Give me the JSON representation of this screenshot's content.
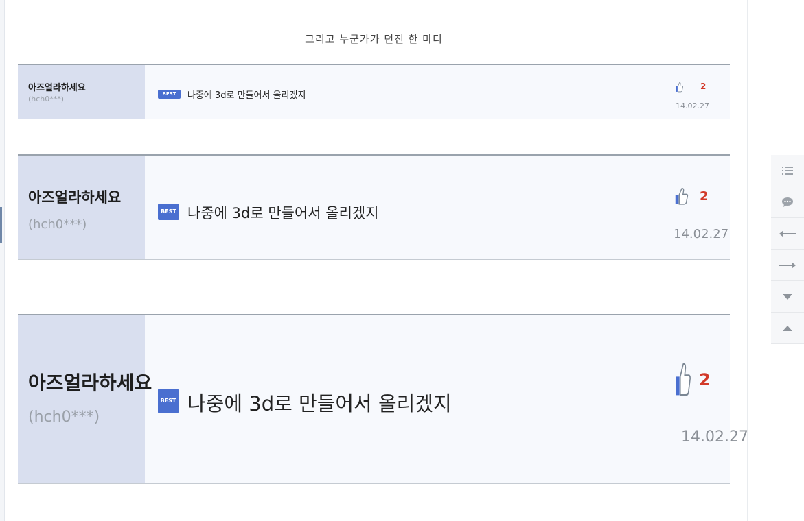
{
  "headline": "그리고 누군가가 던진 한 마디",
  "comments": [
    {
      "nickname": "아즈얼라하세요",
      "user_id": "(hch0***)",
      "badge": "BEST",
      "text": "나중에 3d로 만들어서 올리겠지",
      "likes": "2",
      "date": "14.02.27"
    },
    {
      "nickname": "아즈얼라하세요",
      "user_id": "(hch0***)",
      "badge": "BEST",
      "text": "나중에 3d로 만들어서 올리겠지",
      "likes": "2",
      "date": "14.02.27"
    },
    {
      "nickname": "아즈얼라하세요",
      "user_id": "(hch0***)",
      "badge": "BEST",
      "text": "나중에 3d로 만들어서 올리겠지",
      "likes": "2",
      "date": "14.02.27"
    }
  ],
  "side_toolbar": {
    "buttons": [
      "list-icon",
      "comment-icon",
      "prev-arrow-icon",
      "next-arrow-icon",
      "scroll-down-icon",
      "scroll-up-icon"
    ]
  },
  "colors": {
    "user_panel": "#d9dfef",
    "badge": "#4a6fd0",
    "like_count": "#d23a2a",
    "thumb": "#4a6fd0"
  }
}
